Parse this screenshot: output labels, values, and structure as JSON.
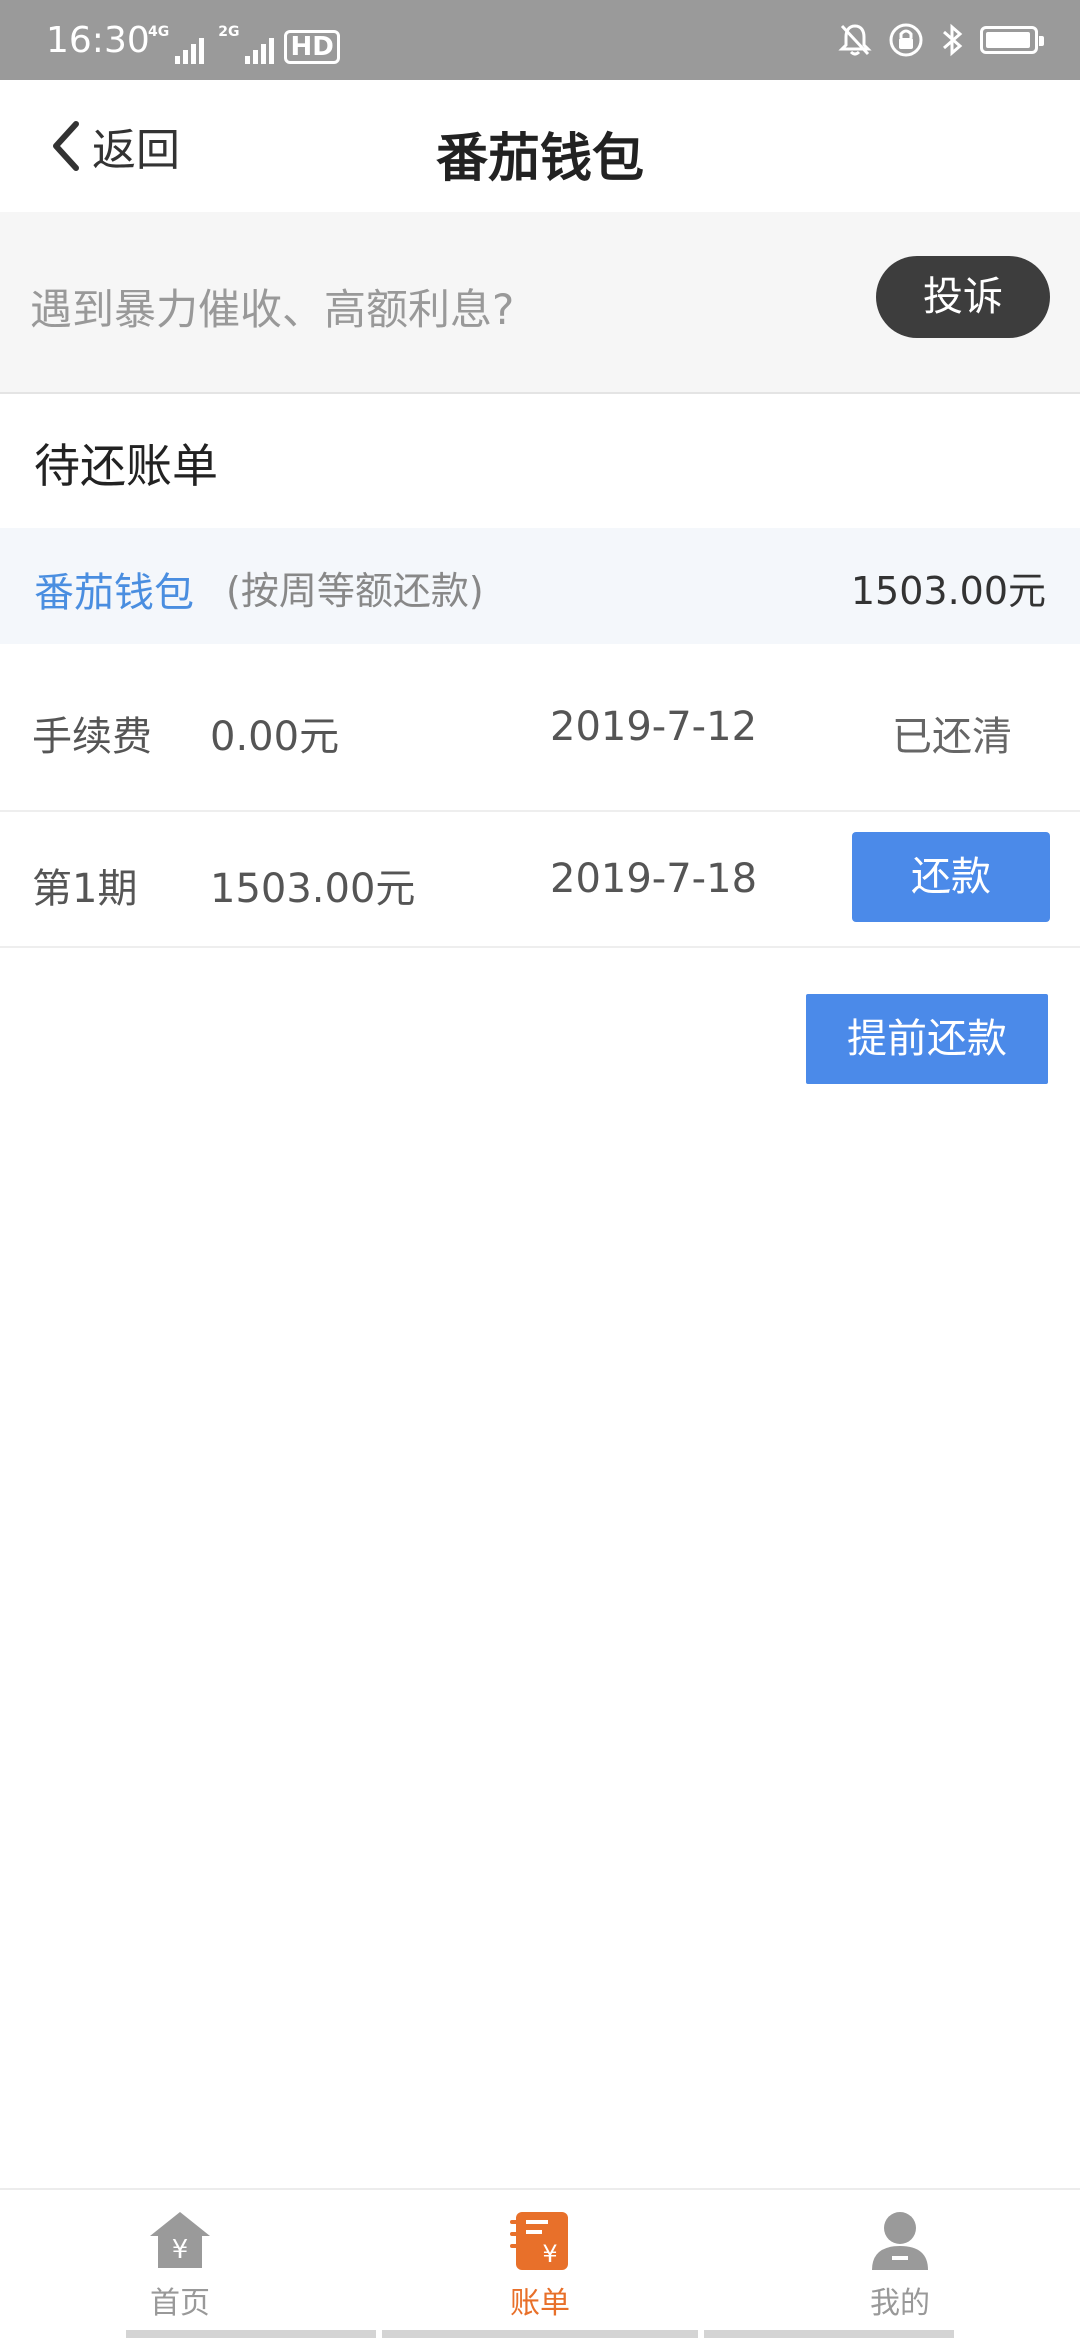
{
  "status_bar": {
    "time": "16:30",
    "sim1_tag": "4G",
    "sim2_tag": "2G",
    "hd_label": "HD"
  },
  "nav": {
    "back_label": "返回",
    "title": "番茄钱包"
  },
  "banner": {
    "text": "遇到暴力催收、高额利息?",
    "complain_label": "投诉"
  },
  "section_title": "待还账单",
  "product": {
    "name": "番茄钱包",
    "method": "(按周等额还款)",
    "amount": "1503.00元"
  },
  "bills": [
    {
      "label": "手续费",
      "amount": "0.00元",
      "date": "2019-7-12",
      "status": "已还清"
    },
    {
      "label": "第1期",
      "amount": "1503.00元",
      "date": "2019-7-18",
      "action_label": "还款"
    }
  ],
  "prepay_label": "提前还款",
  "tabs": [
    {
      "label": "首页",
      "icon": "home-icon",
      "active": false
    },
    {
      "label": "账单",
      "icon": "bill-icon",
      "active": true
    },
    {
      "label": "我的",
      "icon": "user-icon",
      "active": false
    }
  ],
  "colors": {
    "accent_blue": "#4b8ae9",
    "active_tab_orange": "#e8702a",
    "complain_dark": "#3d3d3d"
  }
}
